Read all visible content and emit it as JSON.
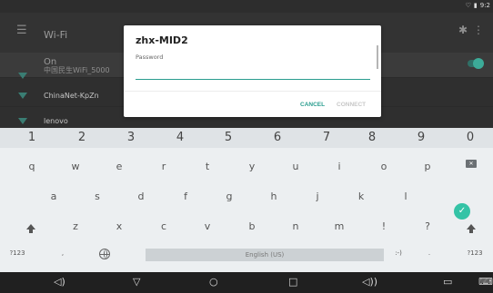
{
  "status": {
    "time": "9:2"
  },
  "appbar": {
    "title": "Wi-Fi"
  },
  "wifi_toggle": {
    "label": "On"
  },
  "networks": [
    {
      "name": "中国民生WiFi_5000"
    },
    {
      "name": "ChinaNet-KpZn"
    },
    {
      "name": "lenovo"
    }
  ],
  "dialog": {
    "title": "zhx-MID2",
    "field_label": "Password",
    "password_value": "",
    "cancel": "CANCEL",
    "connect": "CONNECT"
  },
  "keyboard": {
    "numbers": [
      "1",
      "2",
      "3",
      "4",
      "5",
      "6",
      "7",
      "8",
      "9",
      "0"
    ],
    "row1": [
      "q",
      "w",
      "e",
      "r",
      "t",
      "y",
      "u",
      "i",
      "o",
      "p"
    ],
    "row2": [
      "a",
      "s",
      "d",
      "f",
      "g",
      "h",
      "j",
      "k",
      "l"
    ],
    "row3": [
      "z",
      "x",
      "c",
      "v",
      "b",
      "n",
      "m",
      "!",
      "?"
    ],
    "row4": {
      "symbols": "?123",
      "comma": ",",
      "space": "English (US)",
      "emoji": ":-)",
      "period": ".",
      "symbols_right": "?123"
    }
  },
  "icons": {
    "menu": "☰",
    "settings": "✱",
    "more": "⋮",
    "done": "✓",
    "backspace": "✕",
    "nav_volume_down": "◁)",
    "nav_back": "▽",
    "nav_home": "○",
    "nav_recent": "□",
    "nav_volume_up": "◁))",
    "nav_screenshot": "▭",
    "nav_keyboard": "⌨"
  }
}
